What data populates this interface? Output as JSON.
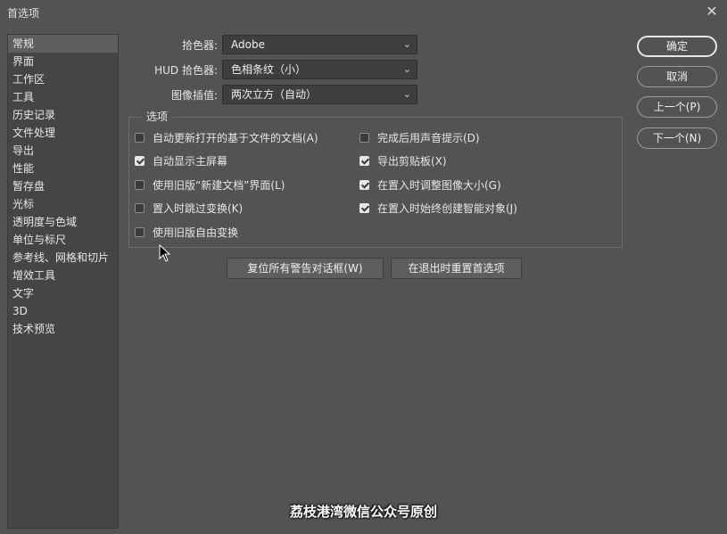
{
  "window": {
    "title": "首选项",
    "close_icon": "close-icon"
  },
  "sidebar": {
    "items": [
      {
        "label": "常规"
      },
      {
        "label": "界面"
      },
      {
        "label": "工作区"
      },
      {
        "label": "工具"
      },
      {
        "label": "历史记录"
      },
      {
        "label": "文件处理"
      },
      {
        "label": "导出"
      },
      {
        "label": "性能"
      },
      {
        "label": "暂存盘"
      },
      {
        "label": "光标"
      },
      {
        "label": "透明度与色域"
      },
      {
        "label": "单位与标尺"
      },
      {
        "label": "参考线、网格和切片"
      },
      {
        "label": "增效工具"
      },
      {
        "label": "文字"
      },
      {
        "label": "3D"
      },
      {
        "label": "技术预览"
      }
    ],
    "selected_index": 0
  },
  "fields": {
    "color_picker": {
      "label": "拾色器:",
      "value": "Adobe"
    },
    "hud_color_picker": {
      "label": "HUD 拾色器:",
      "value": "色相条纹（小）"
    },
    "image_interpolation": {
      "label": "图像插值:",
      "value": "两次立方（自动）"
    }
  },
  "options": {
    "title": "选项",
    "left": [
      {
        "label": "自动更新打开的基于文件的文档(A)",
        "checked": false
      },
      {
        "label": "自动显示主屏幕",
        "checked": true
      },
      {
        "label": "使用旧版“新建文档”界面(L)",
        "checked": false
      },
      {
        "label": "置入时跳过变换(K)",
        "checked": false
      },
      {
        "label": "使用旧版自由变换",
        "checked": false
      }
    ],
    "right": [
      {
        "label": "完成后用声音提示(D)",
        "checked": false
      },
      {
        "label": "导出剪贴板(X)",
        "checked": true
      },
      {
        "label": "在置入时调整图像大小(G)",
        "checked": true
      },
      {
        "label": "在置入时始终创建智能对象(J)",
        "checked": true
      }
    ]
  },
  "bottom_buttons": {
    "reset_warnings": "复位所有警告对话框(W)",
    "reset_prefs_on_quit": "在退出时重置首选项"
  },
  "dialog_buttons": {
    "ok": "确定",
    "cancel": "取消",
    "prev": "上一个(P)",
    "next": "下一个(N)"
  },
  "watermark": "荔枝港湾微信公众号原创"
}
